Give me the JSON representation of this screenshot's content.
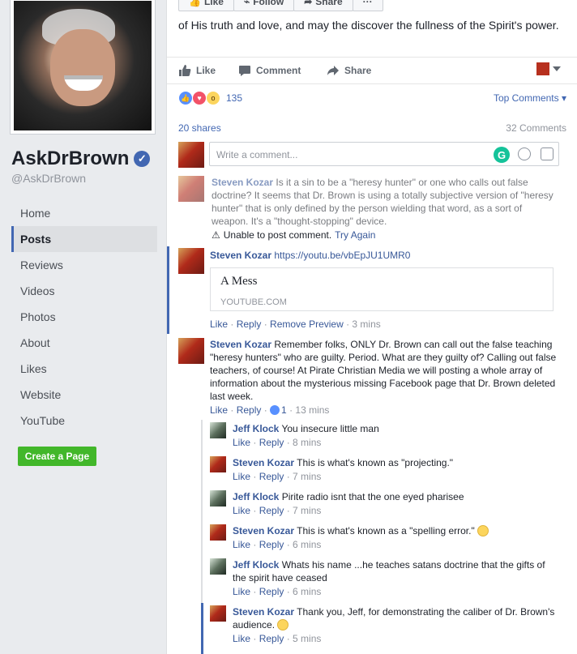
{
  "page": {
    "name": "AskDrBrown",
    "handle": "@AskDrBrown"
  },
  "nav": {
    "items": [
      {
        "label": "Home"
      },
      {
        "label": "Posts"
      },
      {
        "label": "Reviews"
      },
      {
        "label": "Videos"
      },
      {
        "label": "Photos"
      },
      {
        "label": "About"
      },
      {
        "label": "Likes"
      },
      {
        "label": "Website"
      },
      {
        "label": "YouTube"
      }
    ],
    "active": "Posts",
    "create_page": "Create a Page"
  },
  "top_buttons": {
    "like": "Like",
    "follow": "Follow",
    "share": "Share",
    "more": "···"
  },
  "post": {
    "text": "of His truth and love, and may the discover the fullness of the Spirit's power.",
    "actions": {
      "like": "Like",
      "comment": "Comment",
      "share": "Share"
    },
    "reaction_count": "135",
    "top_comments": "Top Comments",
    "shares": "20 shares",
    "comments_count": "32 Comments"
  },
  "comment_input": {
    "placeholder": "Write a comment..."
  },
  "comments": [
    {
      "author": "Steven Kozar",
      "text": "Is it a sin to be a \"heresy hunter\" or one who calls out false doctrine? It seems that Dr. Brown is using a totally subjective version of \"heresy hunter\" that is only defined by the person wielding that word, as a sort of weapon. It's a \"thought-stopping\" device.",
      "error": "Unable to post comment.",
      "retry": "Try Again"
    },
    {
      "author": "Steven Kozar",
      "text": "https://youtu.be/vbEpJU1UMR0",
      "link_title": "A Mess",
      "link_domain": "YOUTUBE.COM",
      "meta": {
        "like": "Like",
        "reply": "Reply",
        "remove": "Remove Preview",
        "time": "3 mins"
      }
    },
    {
      "author": "Steven Kozar",
      "text": "Remember folks, ONLY Dr. Brown can call out the false teaching \"heresy hunters\" who are guilty. Period. What are they guilty of? Calling out false teachers, of course! At Pirate Christian Media we will posting a whole array of information about the mysterious missing Facebook page that Dr. Brown deleted last week.",
      "meta": {
        "like": "Like",
        "reply": "Reply",
        "likes": "1",
        "time": "13 mins"
      }
    }
  ],
  "replies": [
    {
      "author": "Jeff Klock",
      "text": "You insecure little man",
      "time": "8 mins"
    },
    {
      "author": "Steven Kozar",
      "text": "This is what's known as \"projecting.\"",
      "time": "7 mins"
    },
    {
      "author": "Jeff Klock",
      "text": "Pirite radio isnt that the one eyed pharisee",
      "time": "7 mins"
    },
    {
      "author": "Steven Kozar",
      "text": "This is what's known as a \"spelling error.\"",
      "time": "6 mins"
    },
    {
      "author": "Jeff Klock",
      "text": "Whats his name ...he teaches satans doctrine that the gifts of the spirit have ceased",
      "time": "6 mins"
    },
    {
      "author": "Steven Kozar",
      "text": "Thank you, Jeff, for demonstrating the caliber of Dr. Brown's audience.",
      "time": "5 mins"
    }
  ],
  "reply_meta": {
    "like": "Like",
    "reply": "Reply"
  },
  "colors": {
    "accent": "#4267b2",
    "link": "#385898",
    "create_green": "#42b72a"
  }
}
